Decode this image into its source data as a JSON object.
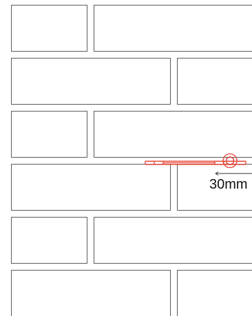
{
  "drawing": {
    "dimension_label": "30mm",
    "brick_rows": 6,
    "colors": {
      "brick_outline": "#5a5a5a",
      "bracket": "#e53b2c",
      "dimension": "#333333",
      "background": "#ffffff"
    },
    "icons": {
      "bracket": "wall-tie-bracket-icon",
      "fixing": "fixing-bolt-icon",
      "dimension_arrow": "double-arrow-icon"
    }
  }
}
